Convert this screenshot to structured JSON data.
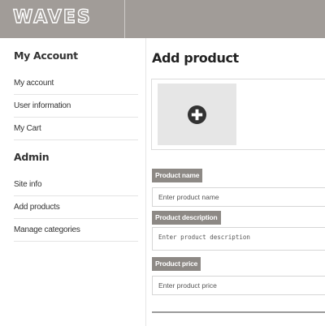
{
  "header": {
    "logo_text": "WAVES",
    "background_color": "#a19c98"
  },
  "sidebar": {
    "sections": [
      {
        "title": "My Account",
        "items": [
          {
            "label": "My account"
          },
          {
            "label": "User information"
          },
          {
            "label": "My Cart"
          }
        ]
      },
      {
        "title": "Admin",
        "items": [
          {
            "label": "Site info"
          },
          {
            "label": "Add products"
          },
          {
            "label": "Manage categories"
          }
        ]
      }
    ]
  },
  "main": {
    "title": "Add product",
    "upload": {
      "icon": "plus-circle-icon"
    },
    "fields": {
      "name": {
        "label": "Product name",
        "placeholder": "Enter product name"
      },
      "description": {
        "label": "Product description",
        "placeholder": "Enter product description"
      },
      "price": {
        "label": "Product price",
        "placeholder": "Enter product price"
      }
    },
    "label_color": "#8d8985"
  }
}
